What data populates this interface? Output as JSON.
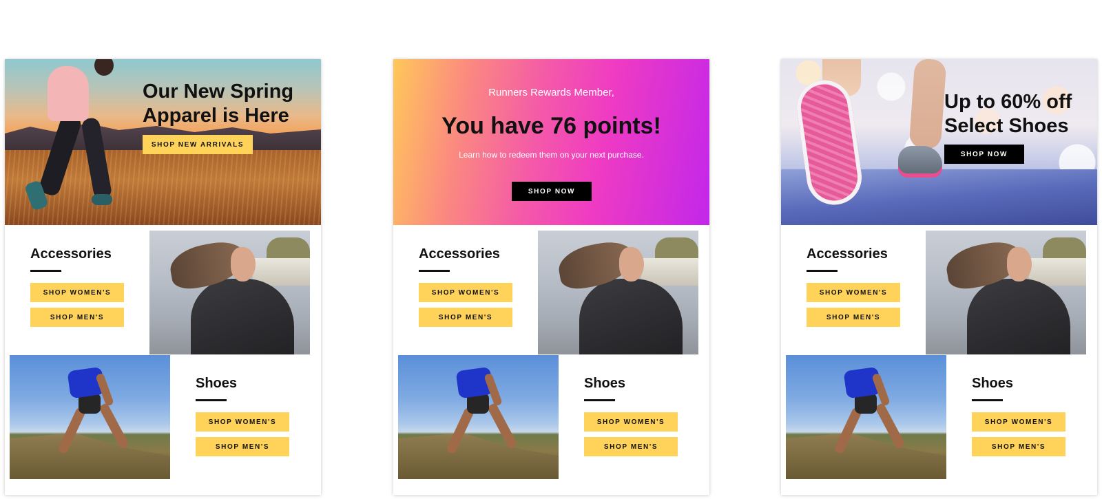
{
  "emails": [
    {
      "hero": {
        "title_line1": "Our New Spring",
        "title_line2": "Apparel is Here",
        "button": "SHOP NEW ARRIVALS"
      }
    },
    {
      "hero": {
        "eyebrow": "Runners Rewards Member,",
        "title": "You have 76 points!",
        "subtitle": "Learn how to redeem them on your next purchase.",
        "button": "SHOP NOW"
      }
    },
    {
      "hero": {
        "title_line1": "Up to 60% off",
        "title_line2": "Select Shoes",
        "button": "SHOP NOW"
      }
    }
  ],
  "sections": {
    "accessories": {
      "title": "Accessories",
      "shop_women": "SHOP WOMEN'S",
      "shop_men": "SHOP MEN'S"
    },
    "shoes": {
      "title": "Shoes",
      "shop_women": "SHOP WOMEN'S",
      "shop_men": "SHOP MEN'S"
    }
  },
  "colors": {
    "accent_yellow": "#ffd25a",
    "button_black": "#000000",
    "rewards_gradient_start": "#ffc85a",
    "rewards_gradient_end": "#c227ea"
  }
}
